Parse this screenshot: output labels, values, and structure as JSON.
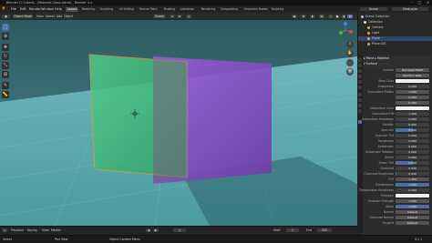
{
  "app": {
    "title": "Blender [C:\\Users\\...\\Material-Glass.blend] - Blender 4.x"
  },
  "menu": {
    "items": [
      "File",
      "Edit",
      "Render",
      "Window",
      "Help"
    ],
    "workspaces": [
      "Layout",
      "Modeling",
      "Sculpting",
      "UV Editing",
      "Texture Paint",
      "Shading",
      "Animation",
      "Rendering",
      "Compositing",
      "Geometry Nodes",
      "Scripting"
    ],
    "active_workspace": "Layout",
    "scene": "Scene",
    "view_layer": "ViewLayer"
  },
  "header": {
    "mode": "Object Mode",
    "view": "View",
    "select": "Select",
    "add": "Add",
    "object": "Object",
    "transform": "Global"
  },
  "viewport": {
    "floor_color": "#4f9aa0",
    "sky_color": "#3b6d74",
    "green_panel_color": "#3fbf72",
    "purple_panel_color": "#8b4fc7"
  },
  "timeline": {
    "playback": "Playback",
    "keying": "Keying",
    "view": "View",
    "marker": "Marker",
    "frame": "1",
    "start_label": "Start",
    "start": "1",
    "end_label": "End",
    "end": "250"
  },
  "statusbar": {
    "left": "Select",
    "mid1": "Pan View",
    "mid2": "Object Context Menu",
    "version": "4.1.1"
  },
  "outliner": {
    "rows": [
      {
        "label": "Scene Collection",
        "color": "#bfbfbf",
        "sel": false
      },
      {
        "label": "Collection",
        "color": "#e0e0e0",
        "sel": false
      },
      {
        "label": "Camera",
        "color": "#e0a060",
        "sel": false
      },
      {
        "label": "Light",
        "color": "#e0a060",
        "sel": false
      },
      {
        "label": "Plane",
        "color": "#e0a060",
        "sel": true
      },
      {
        "label": "Plane.001",
        "color": "#e0a060",
        "sel": false
      }
    ]
  },
  "properties": {
    "object_name": "Plane",
    "material_name": "Material",
    "surface_section": "Surface",
    "surface_type": "Principled BSDF",
    "rows": [
      {
        "label": "Surface",
        "value": "Principled BSDF",
        "kind": "field"
      },
      {
        "label": "",
        "value": "Random Walk",
        "kind": "field"
      },
      {
        "label": "Base Color",
        "value": "",
        "kind": "color"
      },
      {
        "label": "Subsurface",
        "value": "0.000",
        "kind": "slider",
        "fill": 0.0
      },
      {
        "label": "Subsurface Radius",
        "value": "1.000",
        "kind": "field"
      },
      {
        "label": "",
        "value": "0.200",
        "kind": "field"
      },
      {
        "label": "",
        "value": "0.100",
        "kind": "field"
      },
      {
        "label": "Subsurface Color",
        "value": "",
        "kind": "color"
      },
      {
        "label": "Subsurface IOR",
        "value": "1.400",
        "kind": "slider",
        "fill": 0.0
      },
      {
        "label": "Subsurface Anisotropy",
        "value": "0.000",
        "kind": "slider",
        "fill": 0.0
      },
      {
        "label": "Metallic",
        "value": "0.000",
        "kind": "slider",
        "fill": 0.0
      },
      {
        "label": "Specular",
        "value": "0.500",
        "kind": "slider",
        "fill": 0.5
      },
      {
        "label": "Specular Tint",
        "value": "0.000",
        "kind": "slider",
        "fill": 0.0
      },
      {
        "label": "Roughness",
        "value": "0.000",
        "kind": "slider",
        "fill": 0.0
      },
      {
        "label": "Anisotropic",
        "value": "0.000",
        "kind": "slider",
        "fill": 0.0
      },
      {
        "label": "Anisotropic Rotation",
        "value": "0.000",
        "kind": "slider",
        "fill": 0.0
      },
      {
        "label": "Sheen",
        "value": "0.000",
        "kind": "slider",
        "fill": 0.0
      },
      {
        "label": "Sheen Tint",
        "value": "0.500",
        "kind": "slider",
        "fill": 0.5
      },
      {
        "label": "Clearcoat",
        "value": "0.000",
        "kind": "slider",
        "fill": 0.0
      },
      {
        "label": "Clearcoat Roughness",
        "value": "0.030",
        "kind": "slider",
        "fill": 0.03
      },
      {
        "label": "IOR",
        "value": "1.450",
        "kind": "field"
      },
      {
        "label": "Transmission",
        "value": "1.000",
        "kind": "slider",
        "fill": 1.0
      },
      {
        "label": "Transmission Roughness",
        "value": "0.000",
        "kind": "slider",
        "fill": 0.0
      },
      {
        "label": "Emission",
        "value": "",
        "kind": "color"
      },
      {
        "label": "Emission Strength",
        "value": "1.000",
        "kind": "field"
      },
      {
        "label": "Alpha",
        "value": "1.000",
        "kind": "slider",
        "fill": 1.0
      },
      {
        "label": "Normal",
        "value": "Default",
        "kind": "field"
      },
      {
        "label": "Clearcoat Normal",
        "value": "Default",
        "kind": "field"
      },
      {
        "label": "Tangent",
        "value": "Default",
        "kind": "field"
      }
    ]
  }
}
